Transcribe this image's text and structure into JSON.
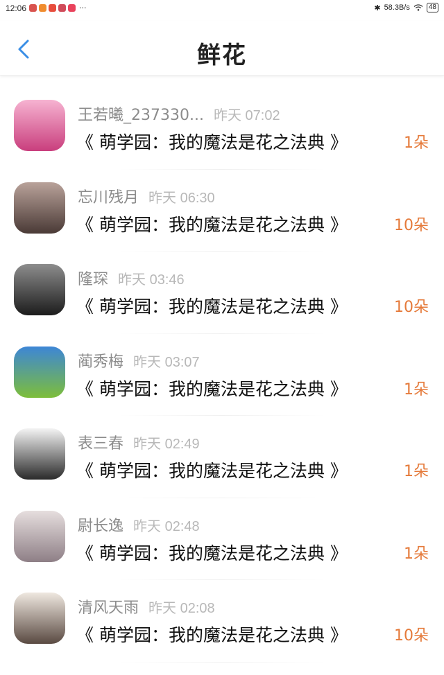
{
  "status_bar": {
    "time": "12:06",
    "notif_colors": [
      "#d9534f",
      "#f08c2e",
      "#e74c3c",
      "#d04b5a",
      "#e9425c"
    ],
    "more": "···",
    "bluetooth": "✱",
    "net_speed": "58.3B/s",
    "battery": "48"
  },
  "header": {
    "title": "鲜花",
    "back_icon": "chevron-left-icon",
    "accent": "#3a8ee6"
  },
  "items": [
    {
      "name": "王若曦_237330...",
      "time": "昨天 07:02",
      "book": "《 萌学园：我的魔法是花之法典 》",
      "count": "1朵",
      "avatar_top": "#f6b3d1",
      "avatar_bottom": "#c93e7d"
    },
    {
      "name": "忘川残月",
      "time": "昨天 06:30",
      "book": "《 萌学园：我的魔法是花之法典 》",
      "count": "10朵",
      "avatar_top": "#b9a29a",
      "avatar_bottom": "#4a3a36"
    },
    {
      "name": "隆琛",
      "time": "昨天 03:46",
      "book": "《 萌学园：我的魔法是花之法典 》",
      "count": "10朵",
      "avatar_top": "#8d8d8d",
      "avatar_bottom": "#1c1c1c"
    },
    {
      "name": "蔺秀梅",
      "time": "昨天 03:07",
      "book": "《 萌学园：我的魔法是花之法典 》",
      "count": "1朵",
      "avatar_top": "#3d86d6",
      "avatar_bottom": "#7dbe3a"
    },
    {
      "name": "表三春",
      "time": "昨天 02:49",
      "book": "《 萌学园：我的魔法是花之法典 》",
      "count": "1朵",
      "avatar_top": "#f4f4f4",
      "avatar_bottom": "#2a2a2a"
    },
    {
      "name": "尉长逸",
      "time": "昨天 02:48",
      "book": "《 萌学园：我的魔法是花之法典 》",
      "count": "1朵",
      "avatar_top": "#e6dede",
      "avatar_bottom": "#8e7f86"
    },
    {
      "name": "清风天雨",
      "time": "昨天 02:08",
      "book": "《 萌学园：我的魔法是花之法典 》",
      "count": "10朵",
      "avatar_top": "#efe8e0",
      "avatar_bottom": "#5a4a42"
    }
  ]
}
